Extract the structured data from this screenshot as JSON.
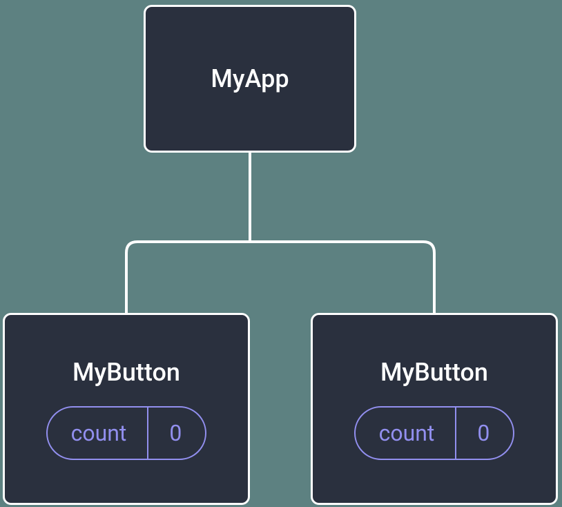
{
  "root": {
    "label": "MyApp"
  },
  "children": {
    "left": {
      "label": "MyButton",
      "state": {
        "key": "count",
        "value": "0"
      }
    },
    "right": {
      "label": "MyButton",
      "state": {
        "key": "count",
        "value": "0"
      }
    }
  },
  "colors": {
    "node_bg": "#2a303e",
    "node_border": "#ffffff",
    "accent": "#928fef",
    "page_bg": "#5d8181"
  }
}
